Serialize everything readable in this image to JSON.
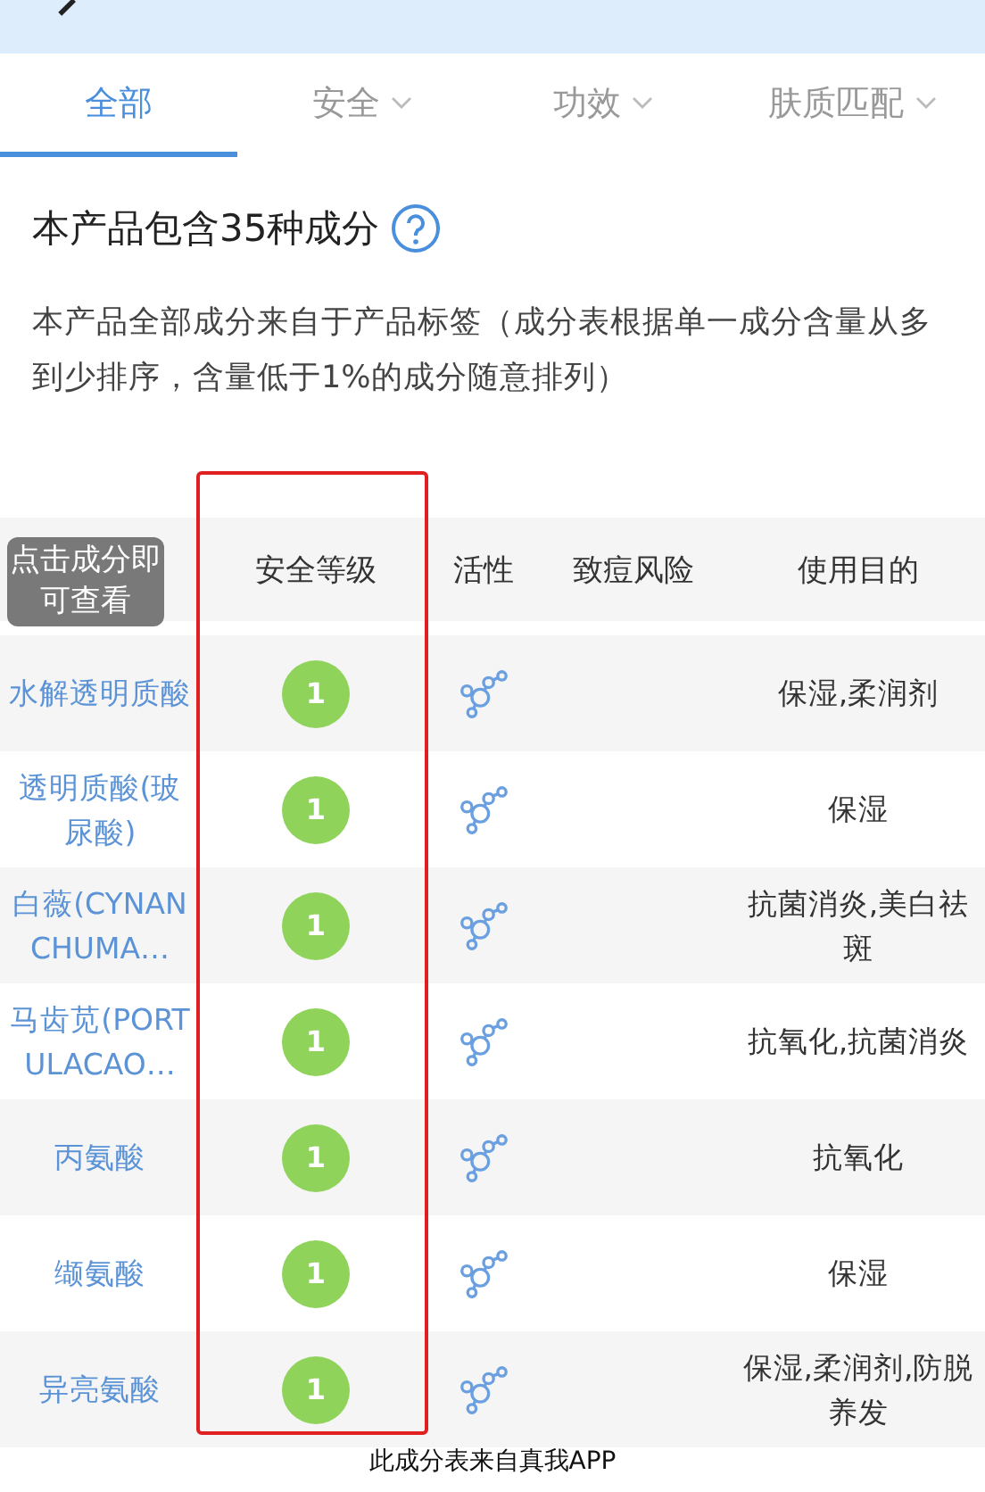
{
  "tabs": [
    {
      "label": "全部",
      "selected": true,
      "dropdown": false
    },
    {
      "label": "安全",
      "selected": false,
      "dropdown": true
    },
    {
      "label": "功效",
      "selected": false,
      "dropdown": true
    },
    {
      "label": "肤质匹配",
      "selected": false,
      "dropdown": true
    }
  ],
  "summary": {
    "title": "本产品包含35种成分",
    "description": "本产品全部成分来自于产品标签（成分表根据单一成分含量从多到少排序，含量低于1%的成分随意排列）"
  },
  "table": {
    "columns": [
      "安全等级",
      "活性",
      "致痘风险",
      "使用目的"
    ],
    "tooltip": "点击成分即可查看",
    "rows": [
      {
        "name": "水解透明质酸",
        "safety": "1",
        "active": true,
        "purpose": "保湿,柔润剂"
      },
      {
        "name": "透明质酸(玻尿酸)",
        "safety": "1",
        "active": true,
        "purpose": "保湿"
      },
      {
        "name": "白薇(CYNANCHUMA…",
        "safety": "1",
        "active": true,
        "purpose": "抗菌消炎,美白祛斑"
      },
      {
        "name": "马齿苋(PORTULACAO…",
        "safety": "1",
        "active": true,
        "purpose": "抗氧化,抗菌消炎"
      },
      {
        "name": "丙氨酸",
        "safety": "1",
        "active": true,
        "purpose": "抗氧化"
      },
      {
        "name": "缬氨酸",
        "safety": "1",
        "active": true,
        "purpose": "保湿"
      },
      {
        "name": "异亮氨酸",
        "safety": "1",
        "active": true,
        "purpose": "保湿,柔润剂,防脱养发"
      }
    ]
  },
  "footer": "此成分表来自真我APP"
}
